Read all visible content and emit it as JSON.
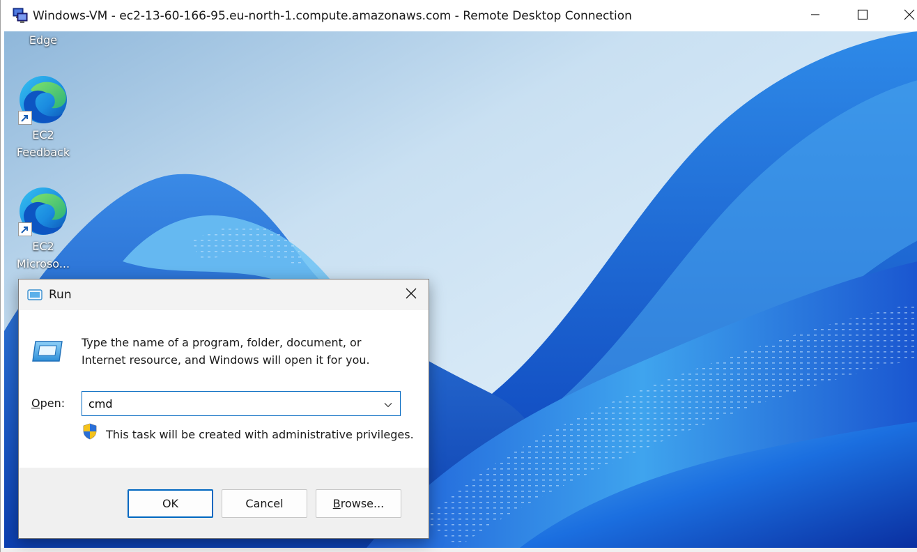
{
  "rdp_window": {
    "title": "Windows-VM - ec2-13-60-166-95.eu-north-1.compute.amazonaws.com - Remote Desktop Connection",
    "app_icon": "remote-desktop-icon",
    "controls": [
      "minimize-icon",
      "maximize-icon",
      "close-icon"
    ]
  },
  "desktop": {
    "wallpaper": "windows-11-bloom",
    "icons": [
      {
        "label_lines": [
          "Edge"
        ],
        "icon": "edge-icon",
        "shortcut": true
      },
      {
        "label_lines": [
          "EC2",
          "Feedback"
        ],
        "icon": "edge-icon",
        "shortcut": true
      },
      {
        "label_lines": [
          "EC2",
          "Microso..."
        ],
        "icon": "edge-icon",
        "shortcut": true
      }
    ]
  },
  "run_dialog": {
    "title": "Run",
    "description_line1": "Type the name of a program, folder, document, or",
    "description_line2": "Internet resource, and Windows will open it for you.",
    "open_label_mnemonic": "O",
    "open_label_rest": "pen:",
    "open_value": "cmd",
    "admin_note": "This task will be created with administrative privileges.",
    "buttons": {
      "ok": "OK",
      "cancel": "Cancel",
      "browse_mnemonic": "B",
      "browse_rest": "rowse..."
    }
  },
  "colors": {
    "accent": "#0067c0",
    "wallpaper_sky": "#bcd8ee",
    "wallpaper_blue": "#1f5fd6"
  }
}
